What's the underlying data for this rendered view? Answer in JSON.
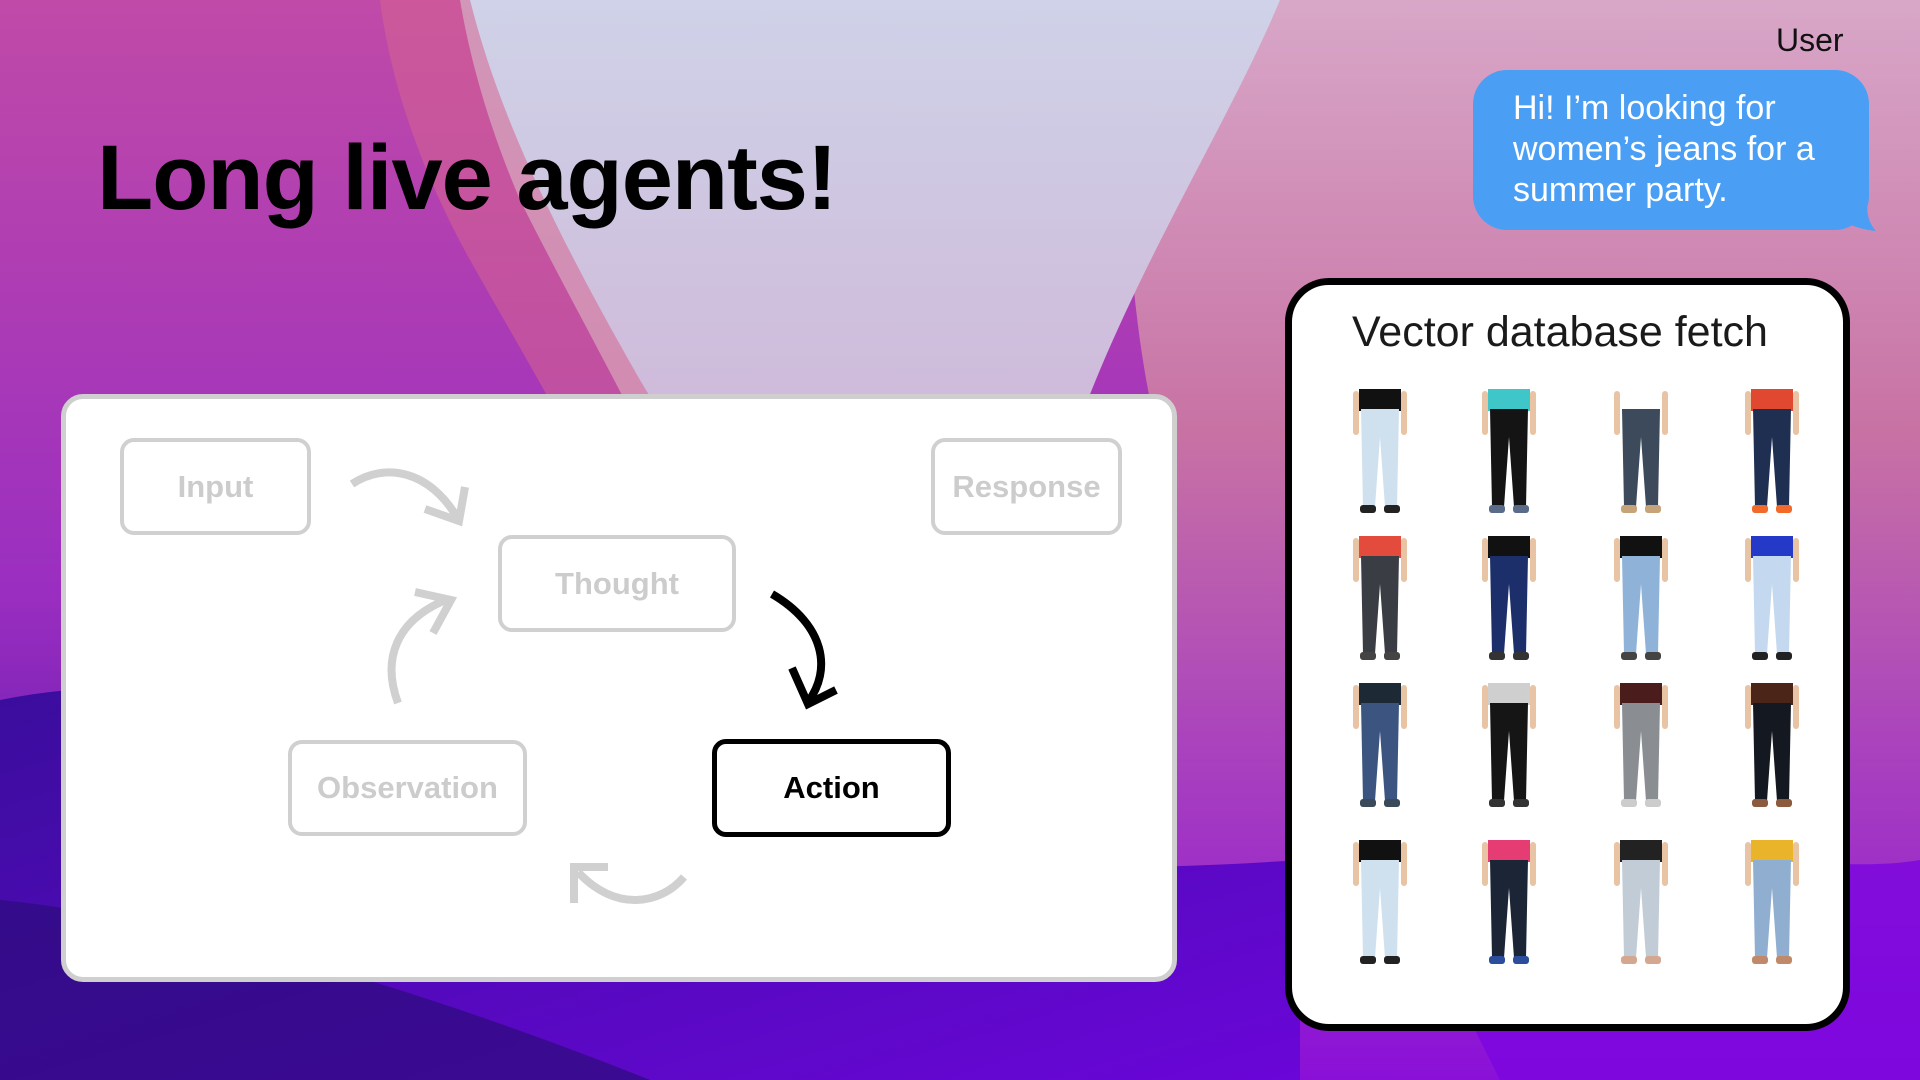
{
  "slide": {
    "title": "Long live agents!",
    "colors": {
      "bg_top_left": "#b63eb0",
      "bg_center_light": "#cfc7e4",
      "bg_right_pink": "#c76ca0",
      "bg_bottom": "#4a08b8",
      "bubble": "#4a9ff5",
      "inactive": "#d0d0d0",
      "active": "#000000"
    }
  },
  "chat": {
    "sender_label": "User",
    "message": "Hi! I’m looking for women’s jeans for a summer party.",
    "message_lines": [
      "Hi! I’m looking for",
      "women’s jeans for a",
      "summer party."
    ]
  },
  "diagram": {
    "nodes": [
      {
        "id": "input",
        "label": "Input",
        "active": false
      },
      {
        "id": "thought",
        "label": "Thought",
        "active": false
      },
      {
        "id": "action",
        "label": "Action",
        "active": true
      },
      {
        "id": "observation",
        "label": "Observation",
        "active": false
      },
      {
        "id": "response",
        "label": "Response",
        "active": false
      }
    ],
    "edges": [
      {
        "from": "input",
        "to": "thought",
        "active": false
      },
      {
        "from": "thought",
        "to": "action",
        "active": true
      },
      {
        "from": "action",
        "to": "observation",
        "active": false
      },
      {
        "from": "observation",
        "to": "thought",
        "active": false
      }
    ]
  },
  "vector_panel": {
    "title": "Vector database fetch",
    "results": [
      {
        "top": "#111111",
        "jeans": "#cfe0ef",
        "shoe": "#222"
      },
      {
        "top": "#3ec6c9",
        "jeans": "#141414",
        "shoe": "#5a6b8a"
      },
      {
        "top": "#ffffff",
        "jeans": "#3d4a5c",
        "shoe": "#c7a37a"
      },
      {
        "top": "#e0492f",
        "jeans": "#1f2f52",
        "shoe": "#f26a2a"
      },
      {
        "top": "#e34b3d",
        "jeans": "#3a3d44",
        "shoe": "#444"
      },
      {
        "top": "#111111",
        "jeans": "#1d2f6a",
        "shoe": "#333"
      },
      {
        "top": "#111111",
        "jeans": "#8fb3d8",
        "shoe": "#444"
      },
      {
        "top": "#2539c9",
        "jeans": "#c4d9ef",
        "shoe": "#222"
      },
      {
        "top": "#1d2a36",
        "jeans": "#3c5580",
        "shoe": "#3a4a5a"
      },
      {
        "top": "#cfcfcf",
        "jeans": "#151515",
        "shoe": "#333"
      },
      {
        "top": "#4a1c1c",
        "jeans": "#8a8d92",
        "shoe": "#ccc"
      },
      {
        "top": "#4a2518",
        "jeans": "#141820",
        "shoe": "#8c5a3c"
      },
      {
        "top": "#111111",
        "jeans": "#cfe0ef",
        "shoe": "#222"
      },
      {
        "top": "#e63c74",
        "jeans": "#1c2536",
        "shoe": "#2c4c9c"
      },
      {
        "top": "#222222",
        "jeans": "#c2ccd6",
        "shoe": "#d4a890"
      },
      {
        "top": "#e9b32a",
        "jeans": "#8faed0",
        "shoe": "#c08a6a"
      }
    ]
  }
}
